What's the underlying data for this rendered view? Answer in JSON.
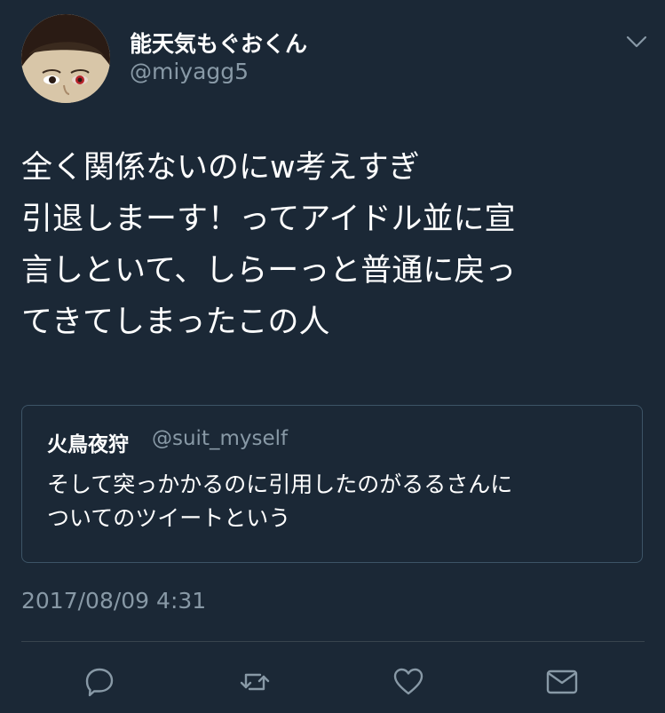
{
  "tweet": {
    "display_name": "能天気もぐおくん",
    "handle": "@miyagg5",
    "text": "全く関係ないのにw考えすぎ\n引退しまーす！ってアイドル並に宣\n言しといて、しらーっと普通に戻っ\nてきてしまったこの人",
    "timestamp": "2017/08/09 4:31"
  },
  "quoted_tweet": {
    "display_name": "火鳥夜狩",
    "handle": "@suit_myself",
    "text": "そして突っかかるのに引用したのがるるさんに\nついてのツイートという"
  },
  "icons": {
    "caret": "chevron-down-icon",
    "reply": "reply-icon",
    "retweet": "retweet-icon",
    "like": "heart-icon",
    "dm": "envelope-icon"
  },
  "colors": {
    "background": "#1b2836",
    "primary_text": "#ffffff",
    "secondary_text": "#8899a6",
    "border": "#3d5466"
  }
}
